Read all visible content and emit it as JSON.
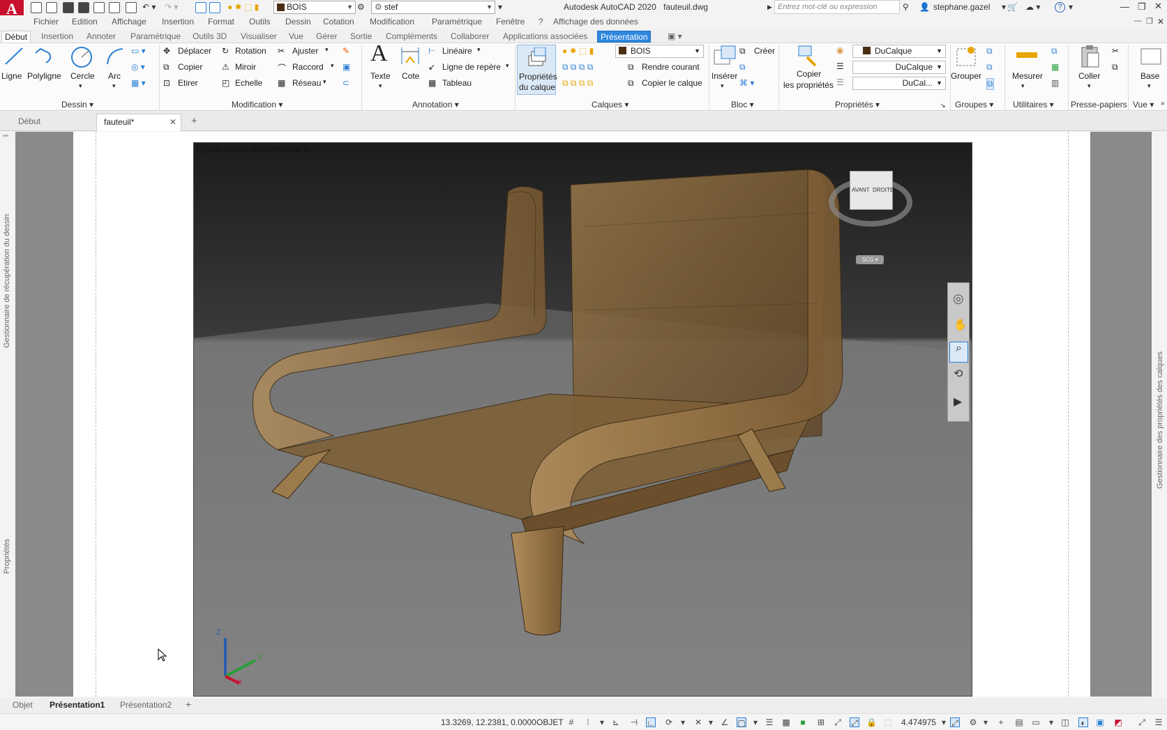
{
  "titlebar": {
    "app_letter": "A",
    "layer_combo": "BOIS",
    "workspace_combo": "stef",
    "title": "Autodesk AutoCAD 2020",
    "filename": "fauteuil.dwg",
    "search_placeholder": "Entrez mot-clé ou expression",
    "user": "stephane.gazel",
    "help": "?"
  },
  "menubar": [
    "Fichier",
    "Edition",
    "Affichage",
    "Insertion",
    "Format",
    "Outils",
    "Dessin",
    "Cotation",
    "Modification",
    "Paramétrique",
    "Fenêtre",
    "?",
    "Affichage des données"
  ],
  "ribbon_tabs": [
    "Début",
    "Insertion",
    "Annoter",
    "Paramétrique",
    "Outils 3D",
    "Visualiser",
    "Vue",
    "Gérer",
    "Sortie",
    "Compléments",
    "Collaborer",
    "Applications associées",
    "Présentation"
  ],
  "ribbon": {
    "dessin": {
      "title": "Dessin",
      "ligne": "Ligne",
      "polyligne": "Polyligne",
      "cercle": "Cercle",
      "arc": "Arc"
    },
    "modification": {
      "title": "Modification",
      "deplacer": "Déplacer",
      "rotation": "Rotation",
      "ajuster": "Ajuster",
      "copier": "Copier",
      "miroir": "Miroir",
      "raccord": "Raccord",
      "etirer": "Etirer",
      "echelle": "Echelle",
      "reseau": "Réseau"
    },
    "annotation": {
      "title": "Annotation",
      "texte": "Texte",
      "cote": "Cote",
      "lineaire": "Linéaire",
      "ligne_repere": "Ligne de repère",
      "tableau": "Tableau"
    },
    "calques": {
      "title": "Calques",
      "proprietes_1": "Propriétés",
      "proprietes_2": "du calque",
      "layer": "BOIS",
      "rendre_courant": "Rendre courant",
      "copier_calque": "Copier le calque"
    },
    "bloc": {
      "title": "Bloc",
      "inserer": "Insérer",
      "creer": "Créer"
    },
    "proprietes": {
      "title": "Propriétés",
      "copier_1": "Copier",
      "copier_2": "les propriétés",
      "color": "DuCalque",
      "linetype": "DuCalque",
      "lineweight": "DuCal..."
    },
    "groupes": {
      "title": "Groupes",
      "grouper": "Grouper"
    },
    "utilitaires": {
      "title": "Utilitaires",
      "mesurer": "Mesurer"
    },
    "presse_papiers": {
      "title": "Presse-papiers",
      "coller": "Coller"
    },
    "vue": {
      "title": "Vue",
      "base": "Base"
    }
  },
  "doc_tabs": {
    "start": "Début",
    "file": "fauteuil*"
  },
  "viewport": {
    "label": "[+][Vue personnalisée][Rayons X]",
    "viewcube_front": "AVANT",
    "viewcube_right": "DROITE",
    "scg": "SCG",
    "ucs_z": "Z",
    "ucs_y": "Y",
    "ucs_x": "X"
  },
  "side_panels": {
    "left_top": "Gestionnaire de récupération du dessin",
    "left_bottom": "Propriétés",
    "right": "Gestionnaire des propriétés des calques"
  },
  "layout_tabs": [
    "Objet",
    "Présentation1",
    "Présentation2"
  ],
  "statusbar": {
    "coords": "13.3269, 12.2381, 0.0000",
    "mode": "OBJET",
    "scale": "4.474975"
  },
  "colors": {
    "autocad_red": "#c8102e",
    "highlight_tab": "#2e86de",
    "wood": "#8b6a3e"
  }
}
